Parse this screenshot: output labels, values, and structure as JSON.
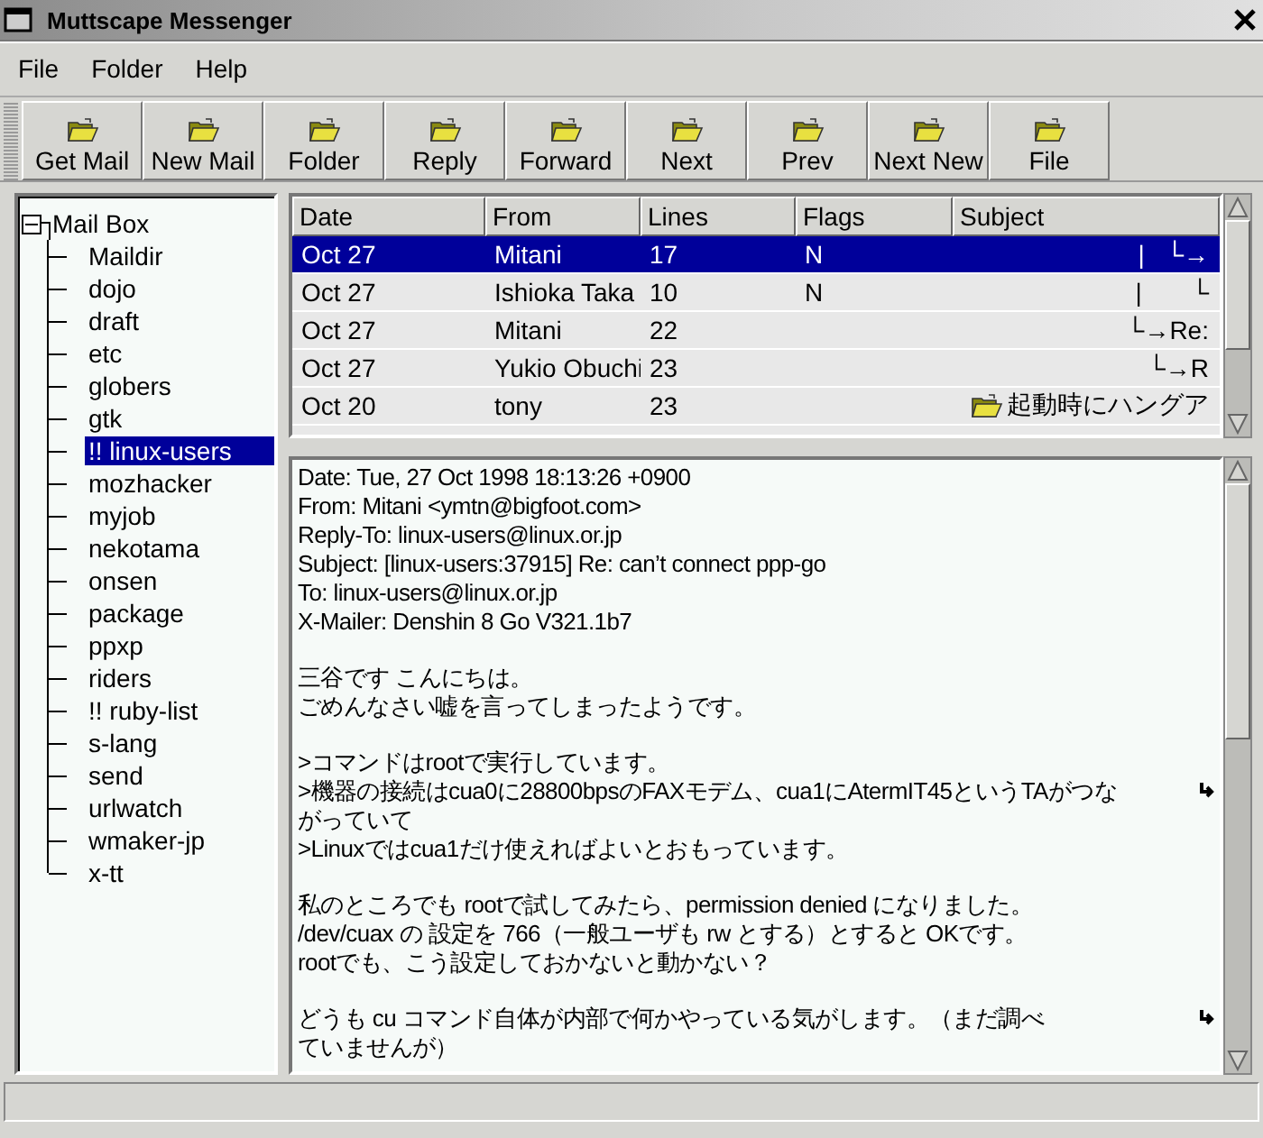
{
  "window": {
    "title": "Muttscape Messenger"
  },
  "menu": [
    "File",
    "Folder",
    "Help"
  ],
  "toolbar": [
    "Get Mail",
    "New Mail",
    "Folder",
    "Reply",
    "Forward",
    "Next",
    "Prev",
    "Next New",
    "File"
  ],
  "folders": {
    "label": "Mail Box",
    "expanded": true,
    "children": [
      {
        "label": "Maildir",
        "selected": false
      },
      {
        "label": "dojo",
        "selected": false
      },
      {
        "label": "draft",
        "selected": false
      },
      {
        "label": "etc",
        "selected": false
      },
      {
        "label": "globers",
        "selected": false
      },
      {
        "label": "gtk",
        "selected": false
      },
      {
        "label": "!! linux-users",
        "selected": true
      },
      {
        "label": "mozhacker",
        "selected": false
      },
      {
        "label": "myjob",
        "selected": false
      },
      {
        "label": "nekotama",
        "selected": false
      },
      {
        "label": "onsen",
        "selected": false
      },
      {
        "label": "package",
        "selected": false
      },
      {
        "label": "ppxp",
        "selected": false
      },
      {
        "label": "riders",
        "selected": false
      },
      {
        "label": "!! ruby-list",
        "selected": false
      },
      {
        "label": "s-lang",
        "selected": false
      },
      {
        "label": "send",
        "selected": false
      },
      {
        "label": "urlwatch",
        "selected": false
      },
      {
        "label": "wmaker-jp",
        "selected": false
      },
      {
        "label": "x-tt",
        "selected": false
      }
    ]
  },
  "messages": {
    "columns": [
      "Date",
      "From",
      "Lines",
      "Flags",
      "Subject"
    ],
    "rows": [
      {
        "date": "Oct 27",
        "from": "Mitani",
        "lines": "17",
        "flags": "N",
        "subject": "|   └→",
        "folder_icon": false,
        "selected": true
      },
      {
        "date": "Oct 27",
        "from": "Ishioka Taka",
        "lines": "10",
        "flags": "N",
        "subject": "|       └",
        "folder_icon": false,
        "selected": false
      },
      {
        "date": "Oct 27",
        "from": "Mitani",
        "lines": "22",
        "flags": "",
        "subject": "└→Re:",
        "folder_icon": false,
        "selected": false
      },
      {
        "date": "Oct 27",
        "from": "Yukio Obuchi",
        "lines": "23",
        "flags": "",
        "subject": "└→R",
        "folder_icon": false,
        "selected": false
      },
      {
        "date": "Oct 20",
        "from": "tony",
        "lines": "23",
        "flags": "",
        "subject": "起動時にハングア",
        "folder_icon": true,
        "selected": false
      }
    ]
  },
  "message_body": [
    [
      {
        "text": "Date: Tue, 27 Oct 1998 18:13:26 +0900",
        "wrapped": false
      },
      {
        "text": "From: Mitani <ymtn@bigfoot.com>",
        "wrapped": false
      },
      {
        "text": "Reply-To: linux-users@linux.or.jp",
        "wrapped": false
      },
      {
        "text": "Subject: [linux-users:37915] Re: can’t connect ppp-go",
        "wrapped": false
      },
      {
        "text": "To: linux-users@linux.or.jp",
        "wrapped": false
      },
      {
        "text": "X-Mailer: Denshin 8 Go V321.1b7",
        "wrapped": false
      }
    ],
    [
      {
        "text": "三谷です  こんにちは。",
        "wrapped": false
      },
      {
        "text": "ごめんなさい嘘を言ってしまったようです。",
        "wrapped": false
      }
    ],
    [
      {
        "text": ">コマンドはrootで実行しています。",
        "wrapped": false
      },
      {
        "text": ">機器の接続はcua0に28800bpsのFAXモデム、cua1にAtermIT45というTAがつな",
        "wrapped": true
      },
      {
        "text": "がっていて",
        "wrapped": false
      },
      {
        "text": ">Linuxではcua1だけ使えればよいとおもっています。",
        "wrapped": false
      }
    ],
    [
      {
        "text": "私のところでも rootで試してみたら、permission denied になりました。",
        "wrapped": false
      },
      {
        "text": "/dev/cuax の 設定を 766（一般ユーザも rw とする）とすると OKです。",
        "wrapped": false
      },
      {
        "text": "rootでも、こう設定しておかないと動かない？",
        "wrapped": false
      }
    ],
    [
      {
        "text": "どうも cu コマンド自体が内部で何かやっている気がします。（まだ調べ",
        "wrapped": true
      },
      {
        "text": "ていませんが）",
        "wrapped": false
      }
    ]
  ]
}
